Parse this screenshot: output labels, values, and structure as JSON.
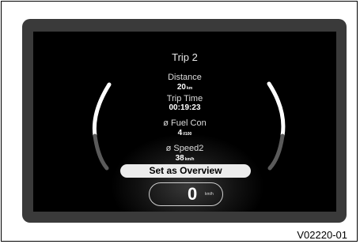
{
  "screen": {
    "title": "Trip 2",
    "items": [
      {
        "label": "Distance",
        "value": "20",
        "unit": "km"
      },
      {
        "label": "Trip Time",
        "value": "00:19:23",
        "unit": ""
      },
      {
        "label": "ø Fuel Con",
        "value": "4",
        "unit": "l/100"
      },
      {
        "label": "ø Speed2",
        "value": "38",
        "unit": "km/h"
      }
    ],
    "overview_button": "Set as Overview",
    "speed": {
      "value": "0",
      "unit": "km/h"
    }
  },
  "caption": "V02220-01",
  "colors": {
    "bezel": "#3a3a3a",
    "screen": "#000000",
    "button": "#ececec"
  }
}
